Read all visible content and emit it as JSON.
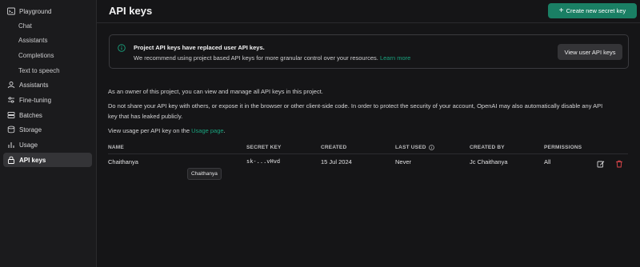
{
  "sidebar": {
    "items": [
      {
        "label": "Playground",
        "icon": "terminal-icon"
      },
      {
        "label": "Chat"
      },
      {
        "label": "Assistants"
      },
      {
        "label": "Completions"
      },
      {
        "label": "Text to speech"
      },
      {
        "label": "Assistants",
        "icon": "assistant-icon"
      },
      {
        "label": "Fine-tuning",
        "icon": "tuning-icon"
      },
      {
        "label": "Batches",
        "icon": "batches-icon"
      },
      {
        "label": "Storage",
        "icon": "storage-icon"
      },
      {
        "label": "Usage",
        "icon": "usage-icon"
      },
      {
        "label": "API keys",
        "icon": "lock-icon",
        "active": true
      }
    ]
  },
  "header": {
    "title": "API keys",
    "create_button": "Create new secret key"
  },
  "notice": {
    "title": "Project API keys have replaced user API keys.",
    "body": "We recommend using project based API keys for more granular control over your resources.",
    "link": "Learn more",
    "button": "View user API keys"
  },
  "info": {
    "owner_text": "As an owner of this project, you can view and manage all API keys in this project.",
    "warning_line1": "Do not share your API key with others, or expose it in the browser or other client-side code. In order to protect the security of your account, OpenAI may also automatically disable any API",
    "warning_line2": "key that has leaked publicly.",
    "usage_prefix": "View usage per API key on the",
    "usage_link": "Usage page",
    "usage_suffix": "."
  },
  "table": {
    "headers": {
      "name": "NAME",
      "secret_key": "SECRET KEY",
      "created": "CREATED",
      "last_used": "LAST USED",
      "created_by": "CREATED BY",
      "permissions": "PERMISSIONS"
    },
    "rows": [
      {
        "name": "Chaithanya",
        "secret_key": "sk-...vHvd",
        "created": "15 Jul 2024",
        "last_used": "Never",
        "created_by": "Jc Chaithanya",
        "permissions": "All"
      }
    ]
  },
  "tooltip": "Chaithanya",
  "colors": {
    "accent": "#1a7f64",
    "link": "#19a37e",
    "danger": "#e5484d",
    "background": "#151517",
    "sidebar": "#1b1b1d"
  }
}
